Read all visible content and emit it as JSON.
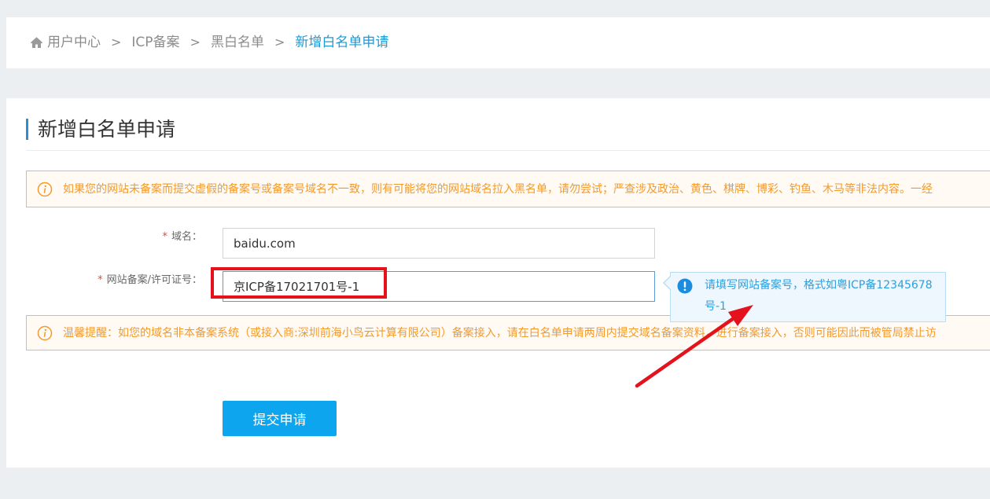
{
  "breadcrumb": {
    "items": [
      "用户中心",
      "ICP备案",
      "黑白名单"
    ],
    "separator": ">",
    "current": "新增白名单申请"
  },
  "page": {
    "title": "新增白名单申请"
  },
  "notice": {
    "text": "如果您的网站未备案而提交虚假的备案号或备案号域名不一致，则有可能将您的网站域名拉入黑名单，请勿尝试；严查涉及政治、黄色、棋牌、博彩、钓鱼、木马等非法内容。一经"
  },
  "form": {
    "domain": {
      "required_mark": "*",
      "label": "域名：",
      "value": "baidu.com"
    },
    "icp": {
      "required_mark": "*",
      "label": "网站备案/许可证号：",
      "value": "京ICP备17021701号-1"
    }
  },
  "tooltip": {
    "text": "请填写网站备案号，格式如粤ICP备12345678号-1"
  },
  "reminder": {
    "text": "温馨提醒：如您的域名非本备案系统（或接入商:深圳前海小鸟云计算有限公司）备案接入，请在白名单申请两周内提交域名备案资料，进行备案接入，否则可能因此而被管局禁止访"
  },
  "actions": {
    "submit_label": "提交申请"
  },
  "icons": {
    "home": "home-icon",
    "notice": "info-circle-icon",
    "reminder": "info-circle-icon",
    "tooltip": "exclamation-circle-icon"
  },
  "colors": {
    "accent": "#1e9ad6",
    "warning": "#f39a2b",
    "button": "#0ea5ef",
    "tooltip_text": "#2d9fdc",
    "required": "#e9473c",
    "annotation": "#e4121c"
  }
}
